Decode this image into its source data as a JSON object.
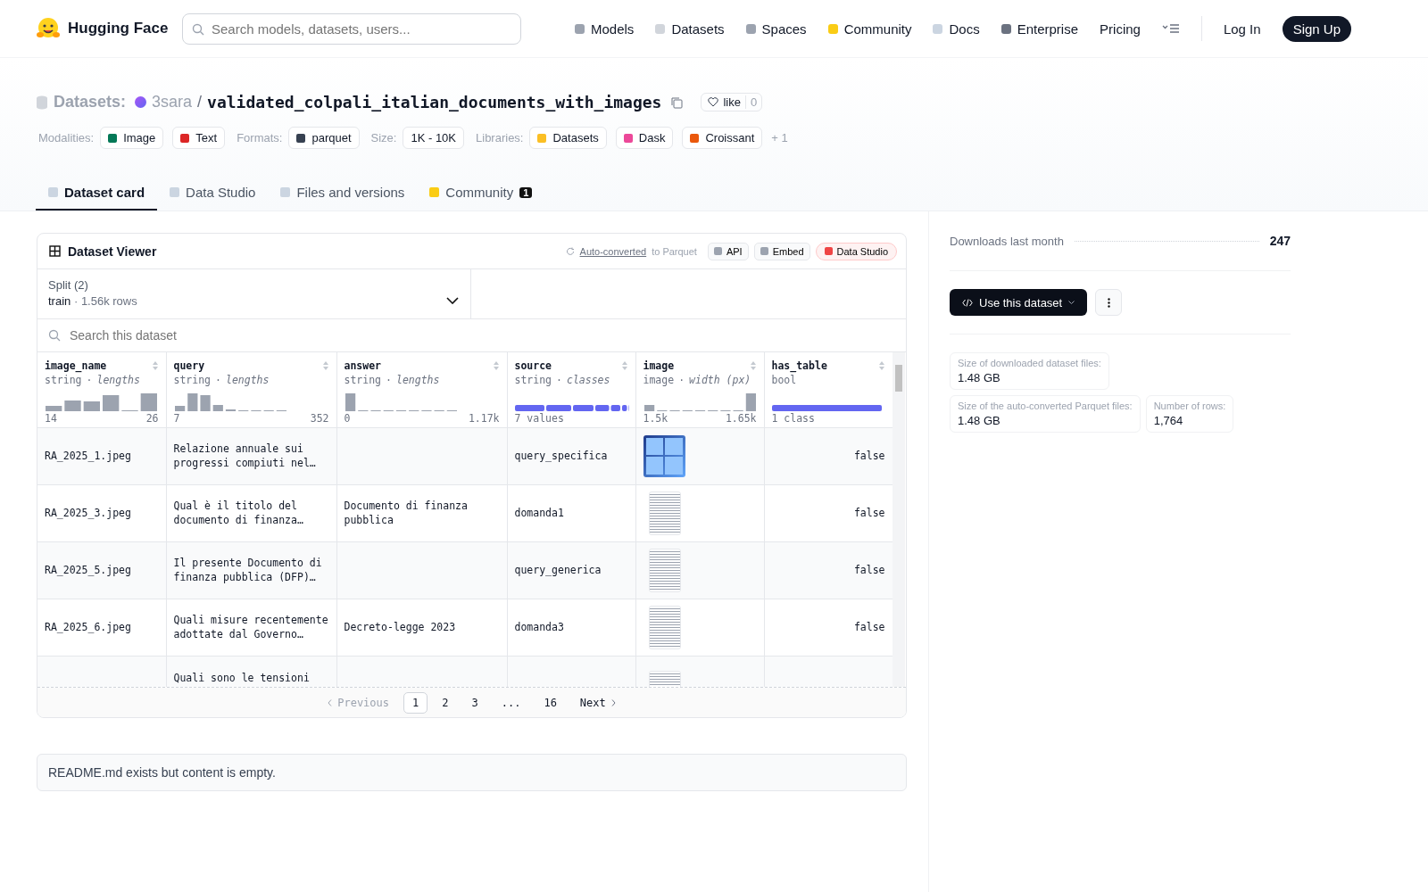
{
  "nav": {
    "brand": "Hugging Face",
    "search_placeholder": "Search models, datasets, users...",
    "links": [
      {
        "label": "Models",
        "kind": "models"
      },
      {
        "label": "Datasets",
        "kind": "datasets"
      },
      {
        "label": "Spaces",
        "kind": "spaces"
      },
      {
        "label": "Community",
        "kind": "community"
      },
      {
        "label": "Docs",
        "kind": "docs"
      },
      {
        "label": "Enterprise",
        "kind": "enterprise"
      },
      {
        "label": "Pricing",
        "kind": "plain"
      }
    ],
    "login": "Log In",
    "signup": "Sign Up"
  },
  "repo": {
    "section": "Datasets:",
    "owner": "3sara",
    "separator": "/",
    "name": "validated_colpali_italian_documents_with_images",
    "like": "like",
    "likes": "0"
  },
  "tag_groups": [
    {
      "label": "Modalities:",
      "chips": [
        {
          "text": "Image",
          "kind": "image"
        },
        {
          "text": "Text",
          "kind": "text"
        }
      ]
    },
    {
      "label": "Formats:",
      "chips": [
        {
          "text": "parquet",
          "kind": "parquet"
        }
      ]
    },
    {
      "label": "Size:",
      "chips": [
        {
          "text": "1K - 10K",
          "kind": "plain"
        }
      ]
    },
    {
      "label": "Libraries:",
      "chips": [
        {
          "text": "Datasets",
          "kind": "hf"
        },
        {
          "text": "Dask",
          "kind": "dask"
        },
        {
          "text": "Croissant",
          "kind": "croissant"
        }
      ]
    }
  ],
  "more_tags": "+ 1",
  "tabs": [
    {
      "label": "Dataset card",
      "kind": "card",
      "selected": true
    },
    {
      "label": "Data Studio",
      "kind": "table",
      "selected": false
    },
    {
      "label": "Files and versions",
      "kind": "files",
      "selected": false
    },
    {
      "label": "Community",
      "kind": "community",
      "selected": false,
      "badge": "1"
    }
  ],
  "viewer": {
    "title": "Dataset Viewer",
    "auto_link": "Auto-converted",
    "auto_rest": "to Parquet",
    "buttons": [
      {
        "label": "API",
        "kind": "api"
      },
      {
        "label": "Embed",
        "kind": "embed"
      },
      {
        "label": "Data Studio",
        "kind": "studio"
      }
    ],
    "split_label": "Split (2)",
    "split_value": "train",
    "split_sep": "·",
    "split_rows": "1.56k rows",
    "type_sep": "·",
    "search_placeholder": "Search this dataset",
    "columns": [
      {
        "name": "image_name",
        "type": "string",
        "stat": "lengths",
        "kind": "histogram",
        "min": "14",
        "max": "26"
      },
      {
        "name": "query",
        "type": "string",
        "stat": "lengths",
        "kind": "histogram",
        "min": "7",
        "max": "352"
      },
      {
        "name": "answer",
        "type": "string",
        "stat": "lengths",
        "kind": "histogram",
        "min": "0",
        "max": "1.17k"
      },
      {
        "name": "source",
        "type": "string",
        "stat": "classes",
        "kind": "classes",
        "summary": "7 values"
      },
      {
        "name": "image",
        "type": "image",
        "stat": "width (px)",
        "kind": "histogram",
        "min": "1.5k",
        "max": "1.65k"
      },
      {
        "name": "has_table",
        "type": "bool",
        "kind": "classes",
        "summary": "1 class"
      }
    ],
    "rows": [
      {
        "image_name": "RA_2025_1.jpeg",
        "query": "Relazione annuale sui progressi compiuti nel…",
        "answer": "",
        "source": "query_specifica",
        "has_table": "false"
      },
      {
        "image_name": "RA_2025_3.jpeg",
        "query": "Qual è il titolo del documento di finanza…",
        "answer": "Documento di finanza pubblica",
        "source": "domanda1",
        "has_table": "false"
      },
      {
        "image_name": "RA_2025_5.jpeg",
        "query": "Il presente Documento di finanza pubblica (DFP)…",
        "answer": "",
        "source": "query_generica",
        "has_table": "false"
      },
      {
        "image_name": "RA_2025_6.jpeg",
        "query": "Quali misure recentemente adottate dal Governo…",
        "answer": "Decreto-legge 2023",
        "source": "domanda3",
        "has_table": "false"
      },
      {
        "image_name": "",
        "query": "Quali sono le tensioni",
        "answer": "",
        "source": "",
        "has_table": ""
      }
    ],
    "pagination": {
      "previous": "Previous",
      "next": "Next",
      "pages": [
        {
          "label": "1",
          "selected": true
        },
        {
          "label": "2",
          "selected": false
        },
        {
          "label": "3",
          "selected": false
        },
        {
          "label": "...",
          "selected": false
        },
        {
          "label": "16",
          "selected": false
        }
      ]
    }
  },
  "readme": "README.md exists but content is empty.",
  "sidebar": {
    "downloads_label": "Downloads last month",
    "downloads": "247",
    "use_button": "Use this dataset",
    "stats": [
      {
        "label": "Size of downloaded dataset files:",
        "value": "1.48 GB"
      },
      {
        "label": "Size of the auto-converted Parquet files:",
        "value": "1.48 GB"
      },
      {
        "label": "Number of rows:",
        "value": "1,764"
      }
    ]
  }
}
